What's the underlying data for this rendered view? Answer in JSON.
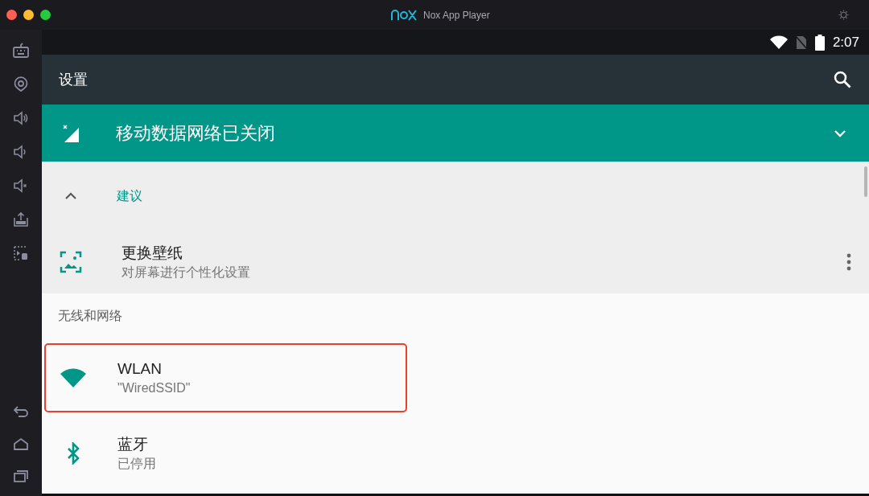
{
  "window": {
    "title": "Nox App Player"
  },
  "status_bar": {
    "time": "2:07"
  },
  "app_bar": {
    "title": "设置"
  },
  "banner": {
    "title": "移动数据网络已关闭",
    "expanded": false
  },
  "suggestions": {
    "header": "建议",
    "expanded": true,
    "items": [
      {
        "title": "更换壁纸",
        "summary": "对屏幕进行个性化设置"
      }
    ]
  },
  "sections": [
    {
      "header": "无线和网络",
      "items": [
        {
          "kind": "wifi",
          "title": "WLAN",
          "summary": "\"WiredSSID\"",
          "highlighted": true
        },
        {
          "kind": "bluetooth",
          "title": "蓝牙",
          "summary": "已停用",
          "highlighted": false
        }
      ]
    }
  ]
}
